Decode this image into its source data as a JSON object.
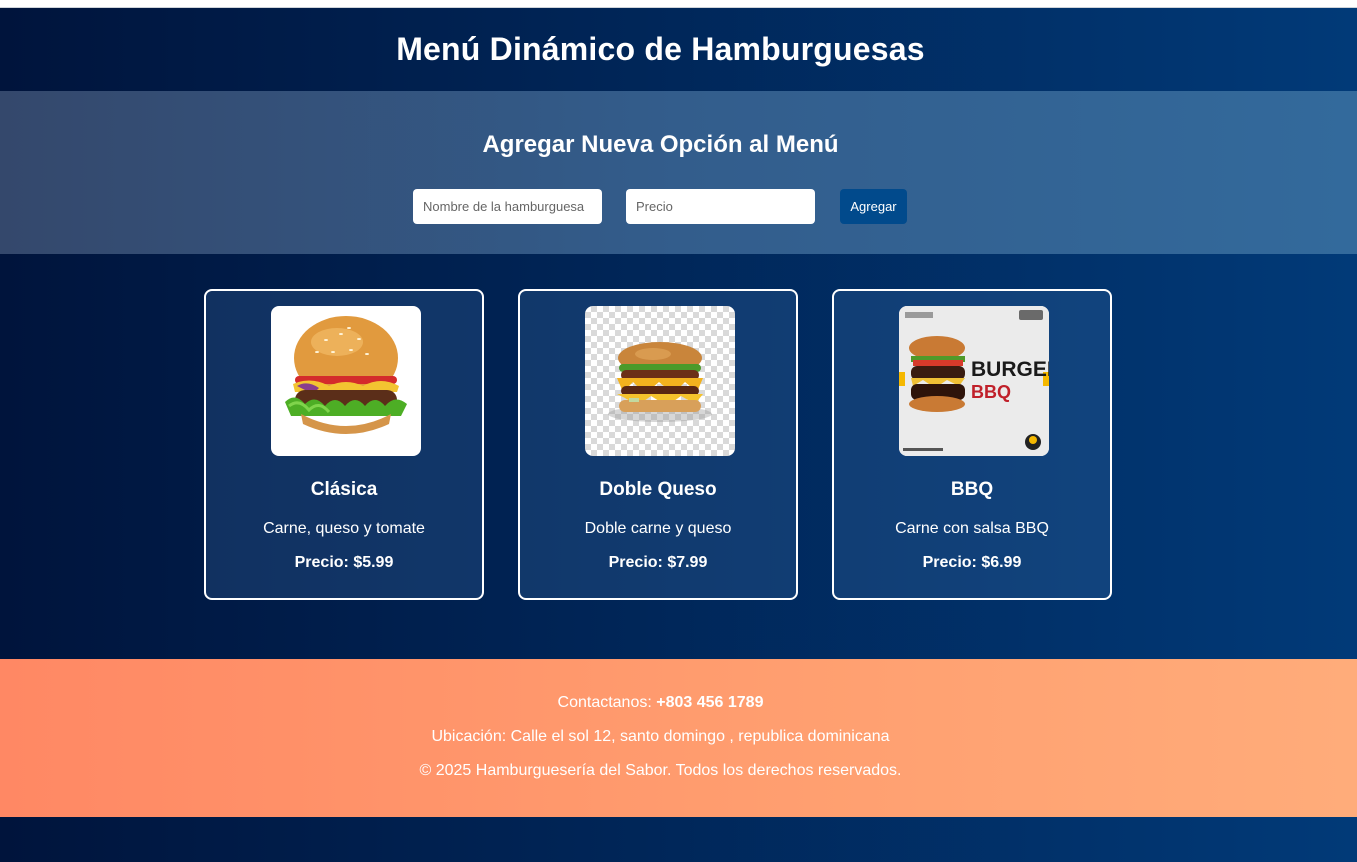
{
  "header": {
    "title": "Menú Dinámico de Hamburguesas"
  },
  "form": {
    "title": "Agregar Nueva Opción al Menú",
    "name_placeholder": "Nombre de la hamburguesa",
    "price_placeholder": "Precio",
    "add_label": "Agregar"
  },
  "menu": [
    {
      "name": "Clásica",
      "description": "Carne, queso y tomate",
      "price": "Precio: $5.99",
      "image": "burger-classic-photo"
    },
    {
      "name": "Doble Queso",
      "description": "Doble carne y queso",
      "price": "Precio: $7.99",
      "image": "burger-double-cheese-photo"
    },
    {
      "name": "BBQ",
      "description": "Carne con salsa BBQ",
      "price": "Precio: $6.99",
      "image": "burger-bbq-poster"
    }
  ],
  "bbq_poster": {
    "line1": "BURGER",
    "line2": "BBQ"
  },
  "footer": {
    "contact_label": "Contactanos: ",
    "contact_phone": "+803 456 1789",
    "location": "Ubicación: Calle el sol 12, santo domingo , republica dominicana",
    "copyright": "© 2025 Hamburguesería del Sabor. Todos los derechos reservados."
  },
  "colors": {
    "header_bg_start": "#00143c",
    "header_bg_end": "#013a78",
    "button": "#014a8c",
    "footer_start": "#ff8864",
    "footer_end": "#ffac7a"
  }
}
